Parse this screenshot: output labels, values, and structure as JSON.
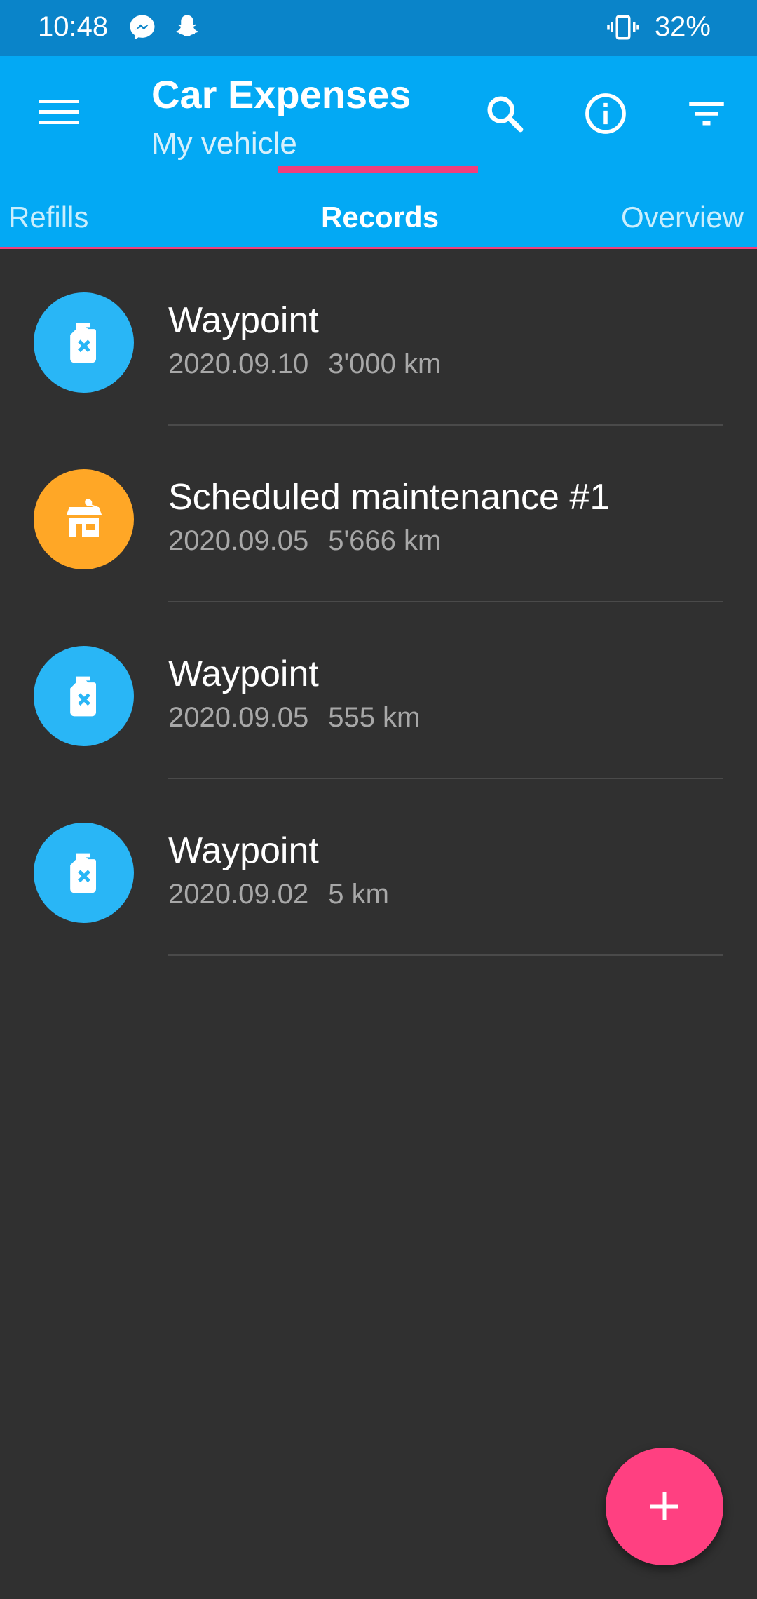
{
  "status_bar": {
    "time": "10:48",
    "battery": "32%",
    "icons": [
      "messenger-icon",
      "snapchat-icon",
      "vibrate-icon"
    ]
  },
  "app_bar": {
    "title": "Car Expenses",
    "subtitle": "My vehicle",
    "actions": [
      "search-icon",
      "info-icon",
      "filter-icon"
    ]
  },
  "tabs": [
    {
      "label": "Refills",
      "active": false
    },
    {
      "label": "Records",
      "active": true
    },
    {
      "label": "Overview",
      "active": false
    }
  ],
  "records": [
    {
      "title": "Waypoint",
      "date": "2020.09.10",
      "distance": "3'000 km",
      "icon": "fuel-can-icon",
      "color": "#29B6F6"
    },
    {
      "title": "Scheduled maintenance #1",
      "date": "2020.09.05",
      "distance": "5'666 km",
      "icon": "service-shop-icon",
      "color": "#FFA726"
    },
    {
      "title": "Waypoint",
      "date": "2020.09.05",
      "distance": "555 km",
      "icon": "fuel-can-icon",
      "color": "#29B6F6"
    },
    {
      "title": "Waypoint",
      "date": "2020.09.02",
      "distance": "5 km",
      "icon": "fuel-can-icon",
      "color": "#29B6F6"
    }
  ],
  "colors": {
    "primary": "#03A9F4",
    "status_bar": "#0A84C9",
    "accent": "#FF4081",
    "background": "#303030"
  },
  "fab": {
    "icon": "plus-icon"
  }
}
